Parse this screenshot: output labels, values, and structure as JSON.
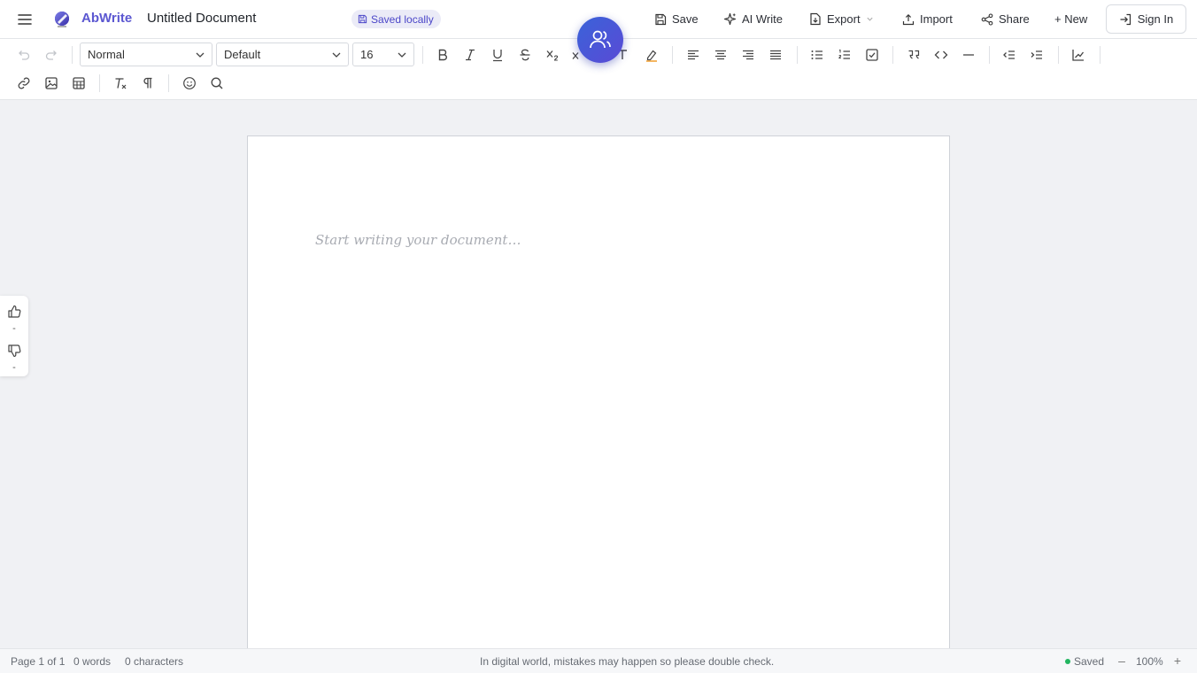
{
  "header": {
    "brand": "AbWrite",
    "doc_title": "Untitled Document",
    "saved_pill": "Saved locally",
    "save_label": "Save",
    "ai_write_label": "AI Write",
    "export_label": "Export",
    "import_label": "Import",
    "share_label": "Share",
    "new_label": "+ New",
    "sign_in_label": "Sign In"
  },
  "toolbar": {
    "block_style": "Normal",
    "font_family": "Default",
    "font_size": "16"
  },
  "editor": {
    "placeholder": "Start writing your document…"
  },
  "feedback": {
    "up_count": "-",
    "down_count": "-"
  },
  "status": {
    "page": "Page 1 of 1",
    "words": "0 words",
    "characters": "0 characters",
    "notice": "In digital world, mistakes may happen so please double check.",
    "save_state": "Saved",
    "zoom": "100%",
    "zoom_out": "–",
    "zoom_in": "+"
  },
  "colors": {
    "brand": "#5b57d1",
    "fab": "#4a5ad8",
    "saved_dot": "#22b560"
  }
}
